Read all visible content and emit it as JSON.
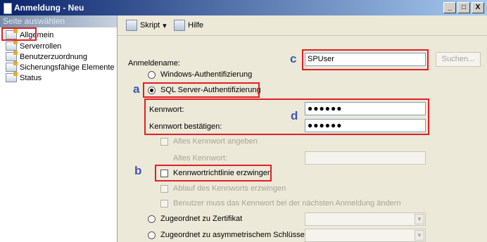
{
  "window": {
    "title": "Anmeldung - Neu",
    "min": "_",
    "max": "□",
    "close": "X"
  },
  "sidebar": {
    "header": "Seite auswählen",
    "items": [
      {
        "label": "Allgemein"
      },
      {
        "label": "Serverrollen"
      },
      {
        "label": "Benutzerzuordnung"
      },
      {
        "label": "Sicherungsfähige Elemente"
      },
      {
        "label": "Status"
      }
    ]
  },
  "toolbar": {
    "script_label": "Skript",
    "script_arrow": "▾",
    "help_label": "Hilfe"
  },
  "form": {
    "login_label": "Anmeldename:",
    "login_value": "SPUser",
    "search_button": "Suchen...",
    "windows_auth": "Windows-Authentifizierung",
    "sql_auth": "SQL Server-Authentifizierung",
    "password_label": "Kennwort:",
    "password_value": "●●●●●●",
    "confirm_label": "Kennwort bestätigen:",
    "confirm_value": "●●●●●●",
    "old_password_check": "Altes Kennwort angeben",
    "old_password_label": "Altes Kennwort:",
    "policy_check": "Kennwortrichtlinie erzwingen",
    "expiration_check": "Ablauf des Kennworts erzwingen",
    "change_check": "Benutzer muss das Kennwort bei der nächsten Anmeldung ändern",
    "cert_option": "Zugeordnet zu Zertifikat",
    "asym_option": "Zugeordnet zu asymmetrischem Schlüssel"
  },
  "markers": {
    "a": "a",
    "b": "b",
    "c": "c",
    "d": "d"
  },
  "colors": {
    "highlight": "#e31e24",
    "marker": "#3f56b5",
    "title_start": "#0a246a"
  }
}
